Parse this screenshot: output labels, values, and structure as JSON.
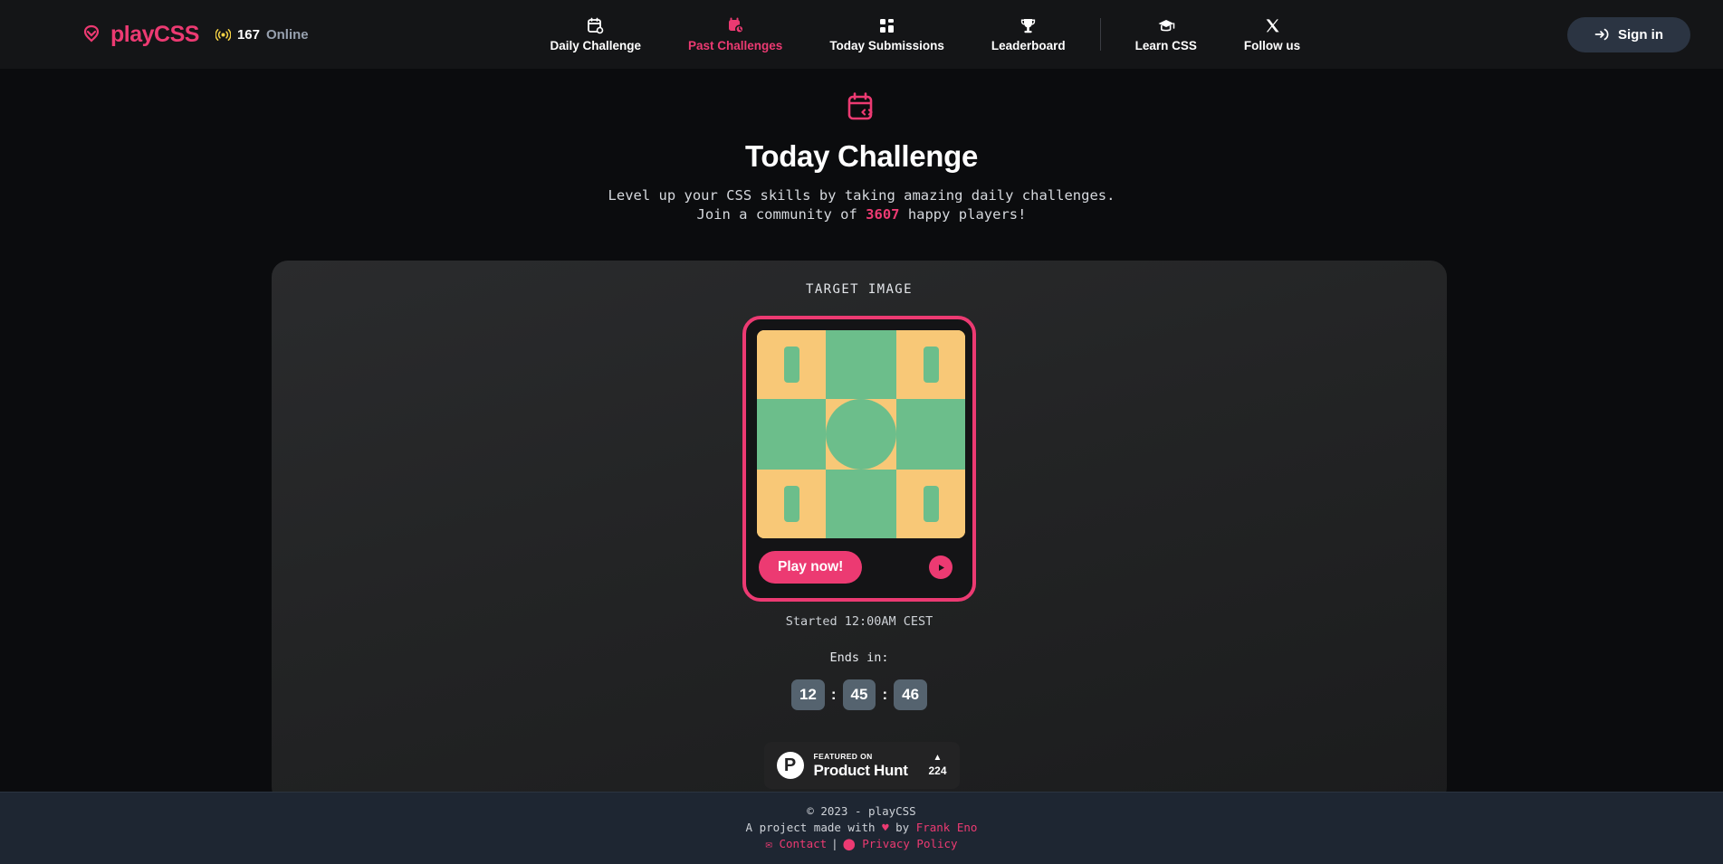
{
  "colors": {
    "accent": "#ec3a72",
    "nav_bg": "#141517",
    "page_bg": "#0b0c0e",
    "card_bg": "#242526",
    "footer_bg": "#1e2632",
    "signin_bg": "#2b3442",
    "countdown_bg": "#55636f",
    "target_green": "#6cbe8b",
    "target_orange": "#f8c877"
  },
  "nav": {
    "brand": "playCSS",
    "brand_icon": "heart-logo-icon",
    "online_count": "167",
    "online_label": "Online",
    "online_icon": "broadcast-icon",
    "items": [
      {
        "label": "Daily Challenge",
        "icon": "calendar-gear-icon",
        "active": false
      },
      {
        "label": "Past Challenges",
        "icon": "calendar-clock-icon",
        "active": true
      },
      {
        "label": "Today Submissions",
        "icon": "grid-blocks-icon",
        "active": false
      },
      {
        "label": "Leaderboard",
        "icon": "trophy-icon",
        "active": false
      },
      {
        "label": "Learn CSS",
        "icon": "graduation-cap-icon",
        "active": false
      },
      {
        "label": "Follow us",
        "icon": "x-twitter-icon",
        "active": false
      }
    ],
    "signin_label": "Sign in",
    "signin_icon": "login-arrow-icon"
  },
  "hero": {
    "icon": "calendar-code-icon",
    "title": "Today Challenge",
    "subtitle_line1": "Level up your CSS skills by taking amazing daily challenges.",
    "subtitle_prefix": "Join a community of ",
    "player_count": "3607",
    "subtitle_suffix": " happy players!"
  },
  "challenge": {
    "target_label": "TARGET IMAGE",
    "play_label": "Play now!",
    "play_icon": "play-triangle-icon",
    "started_text": "Started 12:00AM CEST",
    "ends_label": "Ends in:",
    "countdown": {
      "hours": "12",
      "minutes": "45",
      "seconds": "46",
      "separator": ":"
    },
    "target_pattern": {
      "grid": "3x3",
      "cells": [
        {
          "bg": "orange",
          "shape": "pill"
        },
        {
          "bg": "green",
          "shape": "none"
        },
        {
          "bg": "orange",
          "shape": "pill"
        },
        {
          "bg": "green",
          "shape": "none"
        },
        {
          "bg": "orange",
          "shape": "circle"
        },
        {
          "bg": "green",
          "shape": "none"
        },
        {
          "bg": "orange",
          "shape": "pill"
        },
        {
          "bg": "green",
          "shape": "none"
        },
        {
          "bg": "orange",
          "shape": "pill"
        }
      ]
    }
  },
  "product_hunt": {
    "logo_letter": "P",
    "featured_on": "FEATURED ON",
    "name": "Product Hunt",
    "arrow": "▲",
    "votes": "224"
  },
  "footer": {
    "copyright": "© 2023 - playCSS",
    "made_with_prefix": "A project made with ",
    "heart": "♥",
    "made_with_mid": " by ",
    "author": "Frank Eno",
    "contact_icon": "envelope-icon",
    "contact_label": "Contact",
    "divider": "|",
    "privacy_icon": "shield-icon",
    "privacy_label": "Privacy Policy"
  }
}
